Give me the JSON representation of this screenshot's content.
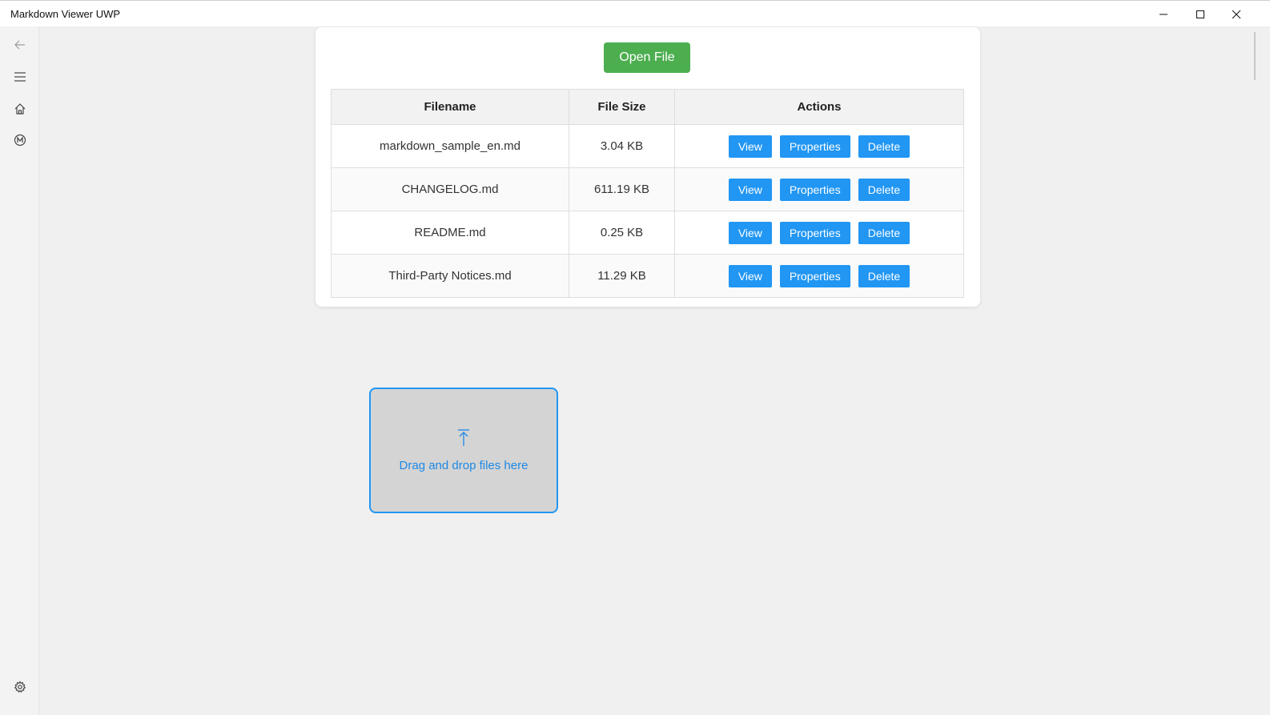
{
  "window": {
    "title": "Markdown Viewer UWP"
  },
  "sidebar": {
    "icons": [
      "back-arrow-icon",
      "hamburger-menu-icon",
      "home-icon",
      "markdown-m-icon",
      "gear-icon"
    ]
  },
  "toolbar": {
    "open_file_label": "Open File"
  },
  "table": {
    "headers": {
      "filename": "Filename",
      "size": "File Size",
      "actions": "Actions"
    },
    "rows": [
      {
        "name": "markdown_sample_en.md",
        "size": "3.04 KB"
      },
      {
        "name": "CHANGELOG.md",
        "size": "611.19 KB"
      },
      {
        "name": "README.md",
        "size": "0.25 KB"
      },
      {
        "name": "Third-Party Notices.md",
        "size": "11.29 KB"
      }
    ],
    "action_labels": {
      "view": "View",
      "properties": "Properties",
      "delete": "Delete"
    }
  },
  "dropzone": {
    "label": "Drag and drop files here"
  },
  "colors": {
    "open_button": "#4cae4f",
    "action_button": "#2196f3",
    "dropzone_border": "#2196f3"
  }
}
